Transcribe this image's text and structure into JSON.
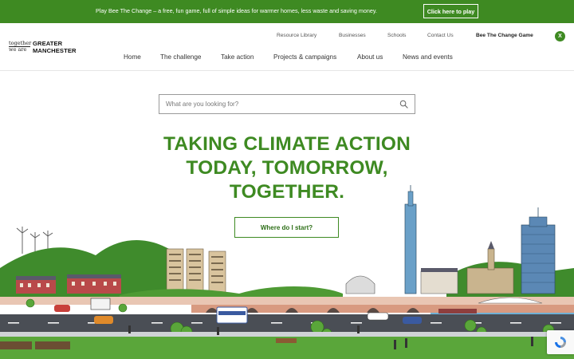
{
  "banner": {
    "text": "Play Bee The Change – a free, fun game, full of simple ideas for warmer homes, less waste and saving money.",
    "button_label": "Click here to play"
  },
  "logo": {
    "small_line1": "together",
    "small_line2": "we are",
    "big_line1": "GREATER",
    "big_line2": "MANCHESTER"
  },
  "utility_nav": [
    {
      "label": "Resource Library"
    },
    {
      "label": "Businesses"
    },
    {
      "label": "Schools"
    },
    {
      "label": "Contact Us"
    },
    {
      "label": "Bee The Change Game"
    }
  ],
  "social": {
    "x_label": "X"
  },
  "main_nav": [
    {
      "label": "Home"
    },
    {
      "label": "The challenge"
    },
    {
      "label": "Take action"
    },
    {
      "label": "Projects & campaigns"
    },
    {
      "label": "About us"
    },
    {
      "label": "News and events"
    }
  ],
  "search": {
    "placeholder": "What are you looking for?",
    "value": ""
  },
  "hero": {
    "line1": "TAKING CLIMATE ACTION",
    "line2": "TODAY, TOMORROW,",
    "line3": "TOGETHER.",
    "cta_label": "Where do I start?"
  },
  "colors": {
    "brand_green": "#3e8a22",
    "hill_green": "#3f8b2c",
    "road_gray": "#4a4e55",
    "grass_green": "#5aa63a"
  }
}
